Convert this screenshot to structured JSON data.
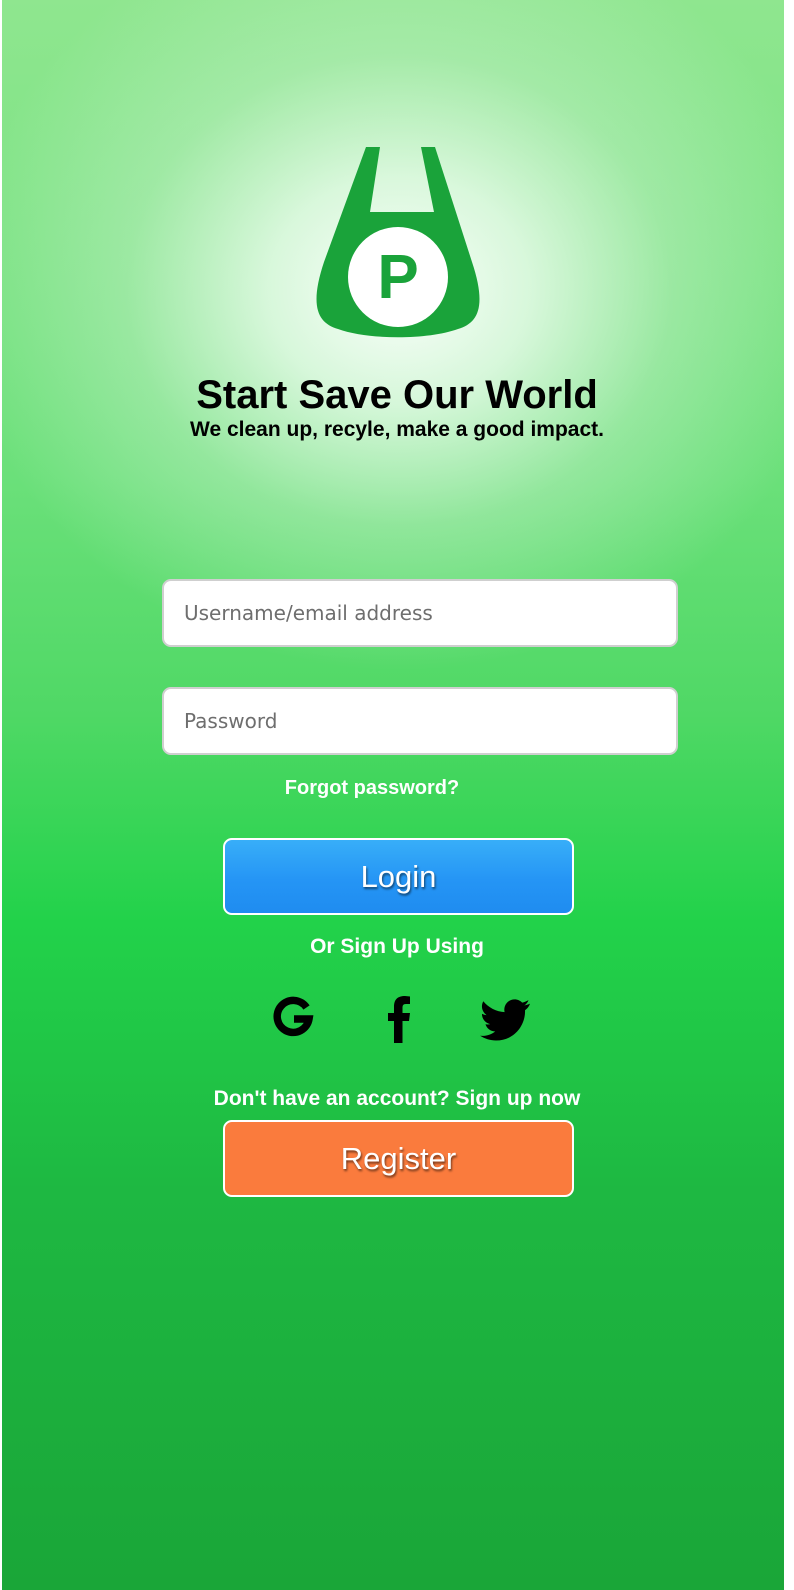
{
  "brand": {
    "logo_icon": "shopping-bag-p-logo",
    "logo_letter": "P",
    "title": "Start Save Our World",
    "tagline": "We clean up, recyle, make a good impact."
  },
  "form": {
    "username_placeholder": "Username/email address",
    "password_placeholder": "Password",
    "forgot_password": "Forgot password?",
    "login_label": "Login"
  },
  "social": {
    "prompt": "Or Sign Up Using",
    "providers": [
      {
        "name": "google",
        "icon": "google-icon"
      },
      {
        "name": "facebook",
        "icon": "facebook-icon"
      },
      {
        "name": "twitter",
        "icon": "twitter-icon"
      }
    ]
  },
  "signup": {
    "prompt": "Don't have an account? Sign up now",
    "register_label": "Register"
  },
  "colors": {
    "logo_green": "#1aa33a",
    "login_blue": "#2595f5",
    "register_orange": "#fa7b3d",
    "background_green": "#22d24a"
  }
}
